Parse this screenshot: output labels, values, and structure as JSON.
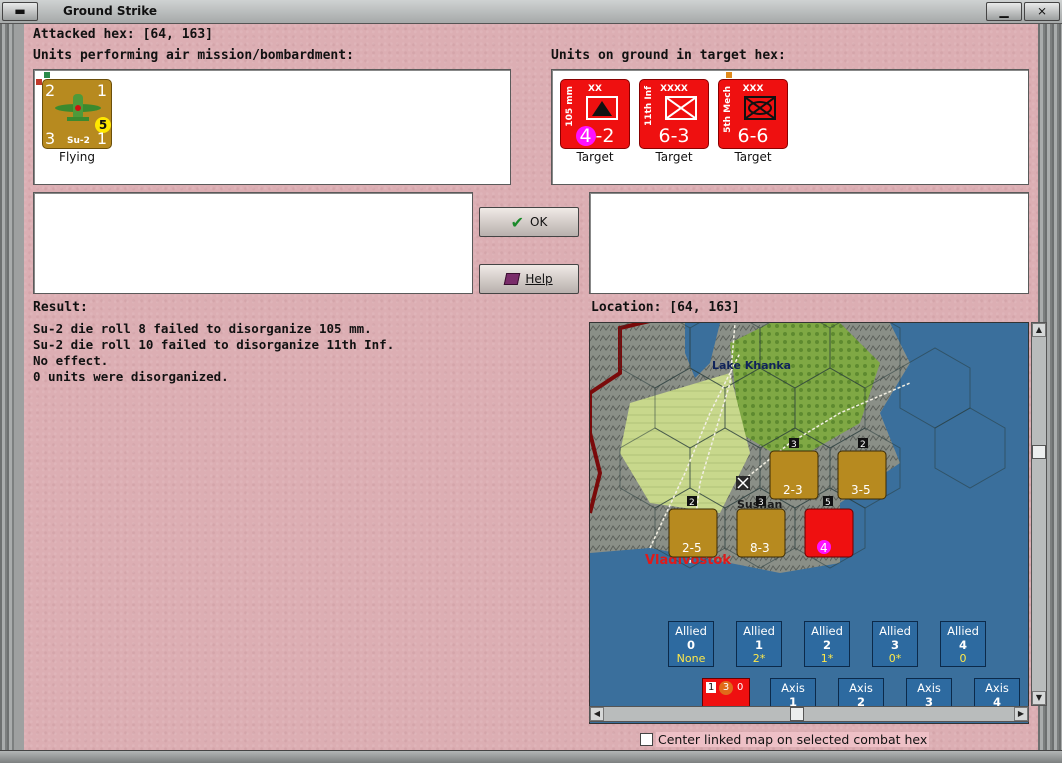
{
  "window": {
    "title": "Ground Strike",
    "sys_left_icon": "window-menu-icon",
    "minimize_icon": "minimize-icon",
    "close_icon": "close-icon"
  },
  "attacked_hex": "Attacked hex:  [64, 163]",
  "air_panel": {
    "label": "Units performing air mission/bombardment:",
    "units": [
      {
        "name": "Su-2",
        "tl": "2",
        "tr": "1",
        "bl": "3",
        "br": "1",
        "badge": "5",
        "status": "Flying",
        "color": "#b78a1f",
        "icon": "aircraft-icon"
      }
    ]
  },
  "ground_panel": {
    "label": "Units on ground in target hex:",
    "units": [
      {
        "side": "105 mm",
        "size": "XX",
        "attack": "4",
        "defense": "2",
        "status": "Target",
        "icon": "artillery-symbol-icon"
      },
      {
        "side": "11th Inf",
        "size": "XXXX",
        "attack": "6",
        "defense": "3",
        "status": "Target",
        "icon": "infantry-symbol-icon"
      },
      {
        "side": "5th Mech",
        "size": "XXX",
        "attack": "6",
        "defense": "6",
        "status": "Target",
        "icon": "mechanized-symbol-icon"
      }
    ]
  },
  "buttons": {
    "ok": "OK",
    "help": "Help",
    "ok_icon": "checkmark-icon",
    "help_icon": "book-icon"
  },
  "result": {
    "label": "Result:",
    "lines": [
      "Su-2 die roll 8 failed to disorganize 105 mm.",
      "Su-2 die roll 10 failed to disorganize 11th Inf.",
      "No effect.",
      "0 units were disorganized."
    ]
  },
  "location": {
    "label": "Location:  [64, 163]",
    "map": {
      "places": [
        "Lake Khanka",
        "Sushan",
        "Vladivostok"
      ],
      "stacks": [
        {
          "count": "3",
          "value": "2-3",
          "color": "#b78a1f"
        },
        {
          "count": "2",
          "value": "3-5",
          "color": "#b78a1f"
        },
        {
          "count": "2",
          "value": "2-5",
          "color": "#b78a1f"
        },
        {
          "count": "3",
          "value": "8-3",
          "color": "#b78a1f"
        },
        {
          "count": "5",
          "value": "4",
          "color": "#ef1010"
        }
      ],
      "allied": [
        {
          "title": "Allied",
          "num": "0",
          "sub": "None"
        },
        {
          "title": "Allied",
          "num": "1",
          "sub": "2*"
        },
        {
          "title": "Allied",
          "num": "2",
          "sub": "1*"
        },
        {
          "title": "Allied",
          "num": "3",
          "sub": "0*"
        },
        {
          "title": "Allied",
          "num": "4",
          "sub": "0"
        }
      ],
      "axis": [
        {
          "title": "Axis",
          "num": "1"
        },
        {
          "title": "Axis",
          "num": "2"
        },
        {
          "title": "Axis",
          "num": "3"
        },
        {
          "title": "Axis",
          "num": "4"
        }
      ],
      "red_chit": {
        "a": "1",
        "b": "3",
        "c": "0"
      }
    }
  },
  "checkbox": {
    "label": "Center linked map on selected combat hex",
    "checked": false
  }
}
